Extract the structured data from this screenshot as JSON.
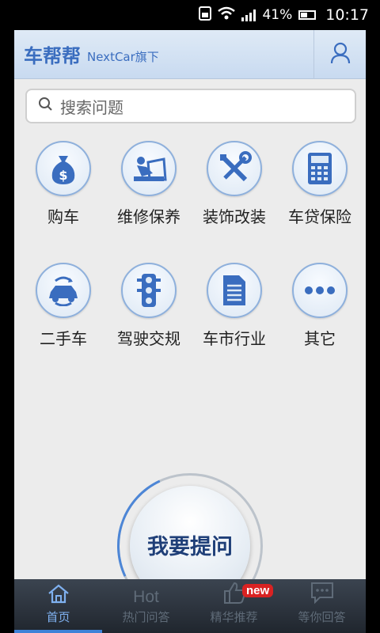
{
  "status_bar": {
    "battery": "41%",
    "time": "10:17"
  },
  "header": {
    "brand": "车帮帮",
    "brand_sub": "NextCar旗下"
  },
  "search": {
    "placeholder": "搜索问题"
  },
  "categories": [
    {
      "label": "购车",
      "icon": "money-bag-icon"
    },
    {
      "label": "维修保养",
      "icon": "car-repair-icon"
    },
    {
      "label": "装饰改装",
      "icon": "tools-icon"
    },
    {
      "label": "车贷保险",
      "icon": "calculator-icon"
    },
    {
      "label": "二手车",
      "icon": "car-exchange-icon"
    },
    {
      "label": "驾驶交规",
      "icon": "traffic-light-icon"
    },
    {
      "label": "车市行业",
      "icon": "document-icon"
    },
    {
      "label": "其它",
      "icon": "more-dots-icon"
    }
  ],
  "ask_button": {
    "label": "我要提问"
  },
  "tabs": [
    {
      "label": "首页",
      "icon": "home-icon",
      "active": true
    },
    {
      "label": "热门问答",
      "icon_text": "Hot",
      "active": false
    },
    {
      "label": "精华推荐",
      "icon": "thumbs-up-icon",
      "badge": "new",
      "active": false
    },
    {
      "label": "等你回答",
      "icon": "chat-bubble-icon",
      "active": false
    }
  ],
  "colors": {
    "accent": "#3a6dbf",
    "tab_active": "#7fb1f0",
    "badge": "#d92222"
  }
}
